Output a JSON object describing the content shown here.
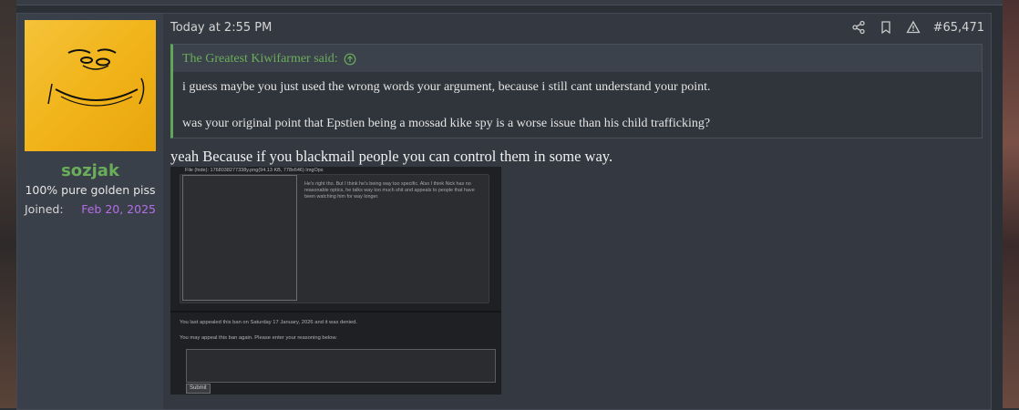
{
  "user": {
    "username": "sozjak",
    "title": "100% pure golden piss",
    "joined_label": "Joined:",
    "joined_date": "Feb 20, 2025"
  },
  "post": {
    "timestamp": "Today at 2:55 PM",
    "number": "#65,471",
    "actions": [
      "share-icon",
      "bookmark-icon",
      "report-icon"
    ],
    "quote": {
      "author": "The Greatest Kiwifarmer said:",
      "lines": [
        "i guess maybe you just used the wrong words your argument, because i still cant understand your point.",
        "was your original point that Epstien being a mossad kike spy is a worse issue than his child trafficking?"
      ]
    },
    "reply_text": "yeah Because if you blackmail people you can control them in some way."
  },
  "attachment": {
    "file_line": "File (hide): 1768038277338y.png(94.13 KB, 778x646) ImgOps",
    "post_text": "He's right tho. But I think he's being way too specific.\nAlso I think Nick has no reasonable optics, he talks way too much shit and appeals to people that have been watching him for way longer.",
    "appeal_note": "You last appealed this ban on Saturday 17 January, 2026 and it was denied.",
    "appeal_prompt": "You may appeal this ban again. Please enter your reasoning below.",
    "submit_label": "Submit"
  },
  "colors": {
    "username": "#6aae5a",
    "joined_date": "#b56ee8",
    "quote_accent": "#5fa85a",
    "avatar_bg": "#f1b41a"
  }
}
